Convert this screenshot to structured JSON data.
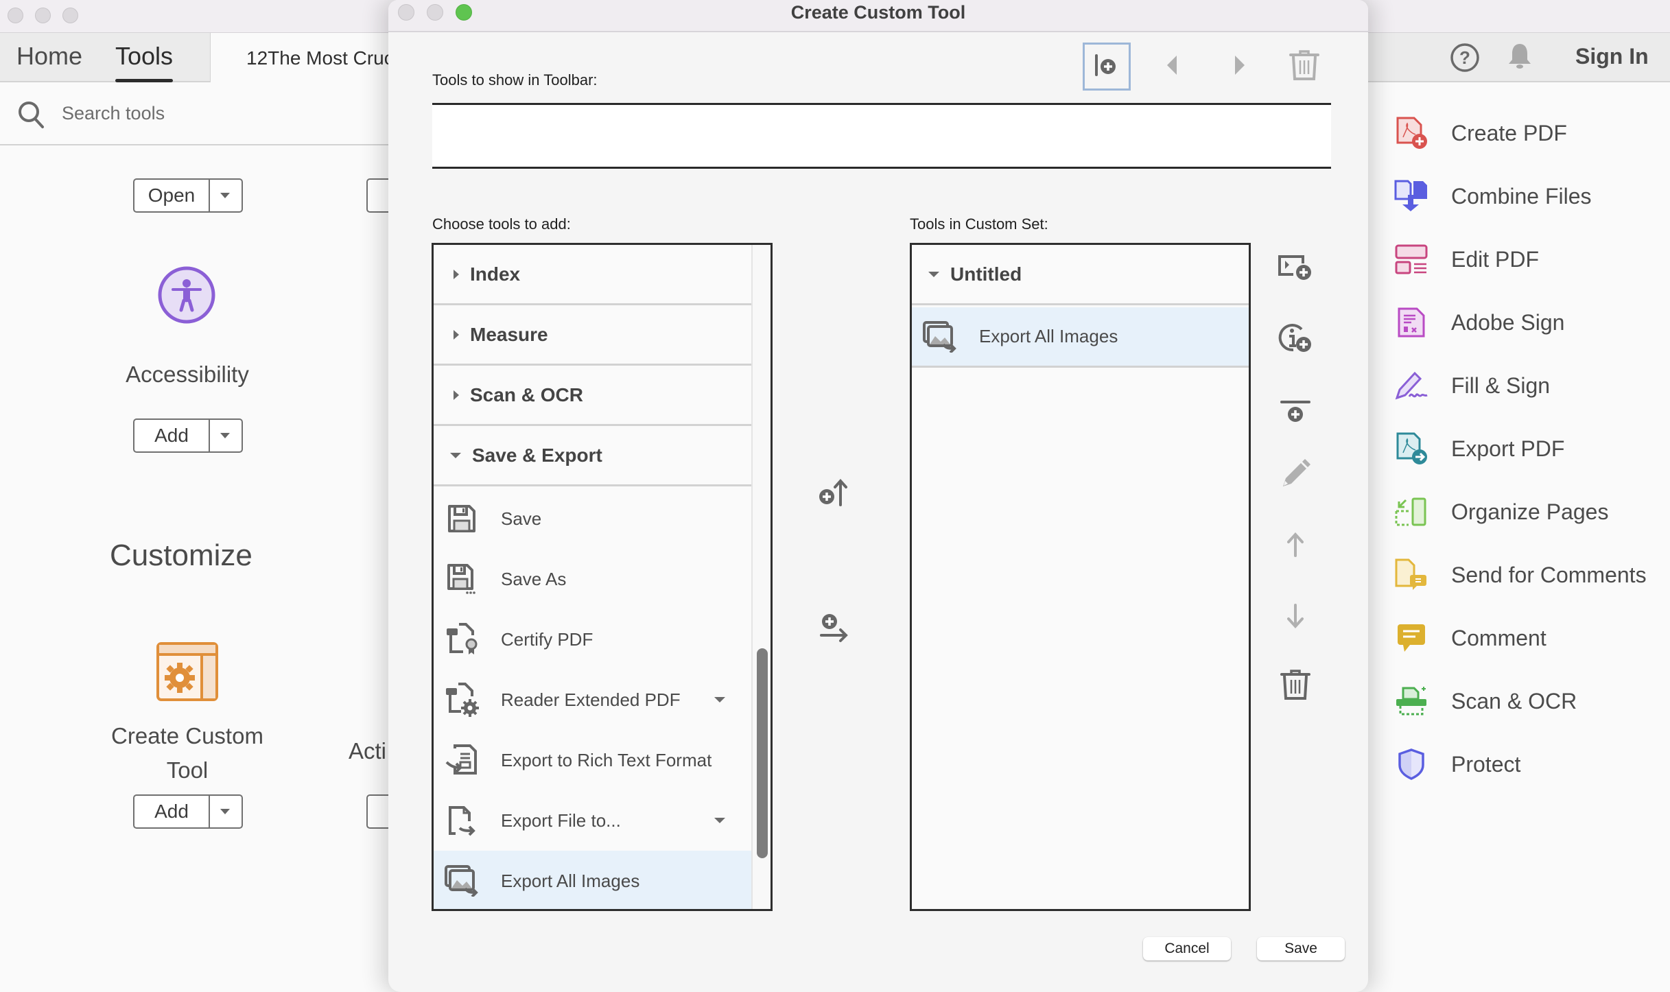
{
  "app": {
    "nav_tabs": [
      {
        "label": "Home",
        "active": false
      },
      {
        "label": "Tools",
        "active": true
      }
    ],
    "document_tab": "12The Most Cruc",
    "search": {
      "placeholder": "Search tools"
    },
    "header_right": {
      "help_icon": "help-icon",
      "notifications_icon": "bell-icon",
      "sign_in": "Sign In"
    }
  },
  "tools_grid": {
    "top_buttons": [
      {
        "label": "Open"
      }
    ],
    "accessibility": {
      "title": "Accessibility",
      "button": "Add",
      "icon": "accessibility-icon",
      "color": "#8b5fd6"
    },
    "customize_section": "Customize",
    "create_custom_tool": {
      "title_line1": "Create Custom",
      "title_line2": "Tool",
      "button": "Add",
      "icon": "custom-tool-gear-icon",
      "color": "#e08f3a"
    },
    "partial_tool": {
      "title": "Acti"
    }
  },
  "right_panel": {
    "items": [
      {
        "label": "Create PDF",
        "icon": "create-pdf-icon",
        "color": "#d9534f"
      },
      {
        "label": "Combine Files",
        "icon": "combine-files-icon",
        "color": "#5a5ee0"
      },
      {
        "label": "Edit PDF",
        "icon": "edit-pdf-icon",
        "color": "#c8457f"
      },
      {
        "label": "Adobe Sign",
        "icon": "adobe-sign-icon",
        "color": "#b94bc4"
      },
      {
        "label": "Fill & Sign",
        "icon": "fill-sign-icon",
        "color": "#8a5fd6"
      },
      {
        "label": "Export PDF",
        "icon": "export-pdf-icon",
        "color": "#2e8a99"
      },
      {
        "label": "Organize Pages",
        "icon": "organize-pages-icon",
        "color": "#7ac453"
      },
      {
        "label": "Send for Comments",
        "icon": "send-for-comments-icon",
        "color": "#e3b73c"
      },
      {
        "label": "Comment",
        "icon": "comment-icon",
        "color": "#dcb02e"
      },
      {
        "label": "Scan & OCR",
        "icon": "scan-ocr-icon",
        "color": "#4caf50"
      },
      {
        "label": "Protect",
        "icon": "protect-icon",
        "color": "#5a5ee0"
      }
    ]
  },
  "dialog": {
    "title": "Create Custom Tool",
    "toolbar_label": "Tools to show in Toolbar:",
    "toolbar_buttons": [
      {
        "name": "add-separator",
        "icon": "add-separator-icon",
        "selected": true,
        "enabled": true
      },
      {
        "name": "move-left",
        "icon": "arrow-left-icon",
        "enabled": false
      },
      {
        "name": "move-right",
        "icon": "arrow-right-icon",
        "enabled": false
      },
      {
        "name": "delete",
        "icon": "trash-icon",
        "enabled": false
      }
    ],
    "choose_label": "Choose tools to add:",
    "custom_set_label": "Tools in Custom Set:",
    "available_groups": [
      {
        "label": "Index",
        "expanded": false
      },
      {
        "label": "Measure",
        "expanded": false
      },
      {
        "label": "Scan & OCR",
        "expanded": false
      },
      {
        "label": "Save & Export",
        "expanded": true
      }
    ],
    "available_tools": [
      {
        "label": "Save",
        "icon": "save-icon",
        "has_dropdown": false,
        "selected": false
      },
      {
        "label": "Save As",
        "icon": "save-as-icon",
        "has_dropdown": false,
        "selected": false
      },
      {
        "label": "Certify PDF",
        "icon": "certify-pdf-icon",
        "has_dropdown": false,
        "selected": false
      },
      {
        "label": "Reader Extended PDF",
        "icon": "reader-extended-pdf-icon",
        "has_dropdown": true,
        "selected": false
      },
      {
        "label": "Export to Rich Text Format",
        "icon": "export-rtf-icon",
        "has_dropdown": false,
        "selected": false
      },
      {
        "label": "Export File to...",
        "icon": "export-file-icon",
        "has_dropdown": true,
        "selected": false
      },
      {
        "label": "Export All Images",
        "icon": "export-images-icon",
        "has_dropdown": false,
        "selected": true
      }
    ],
    "transfer_buttons": [
      {
        "name": "add-to-toolbar",
        "icon": "add-to-toolbar-icon"
      },
      {
        "name": "add-to-custom-set",
        "icon": "add-to-set-icon"
      }
    ],
    "custom_set": {
      "group": {
        "label": "Untitled",
        "expanded": true
      },
      "tools": [
        {
          "label": "Export All Images",
          "icon": "export-images-icon",
          "selected": true
        }
      ]
    },
    "custom_set_actions": [
      {
        "name": "new-panel",
        "icon": "new-panel-icon",
        "enabled": true
      },
      {
        "name": "new-info",
        "icon": "info-add-icon",
        "enabled": true
      },
      {
        "name": "add-divider",
        "icon": "add-divider-icon",
        "enabled": true
      },
      {
        "name": "rename",
        "icon": "pencil-icon",
        "enabled": false
      },
      {
        "name": "move-up",
        "icon": "arrow-up-icon",
        "enabled": false
      },
      {
        "name": "move-down",
        "icon": "arrow-down-icon",
        "enabled": false
      },
      {
        "name": "delete",
        "icon": "trash-icon",
        "enabled": true
      }
    ],
    "cancel_label": "Cancel",
    "save_label": "Save"
  }
}
